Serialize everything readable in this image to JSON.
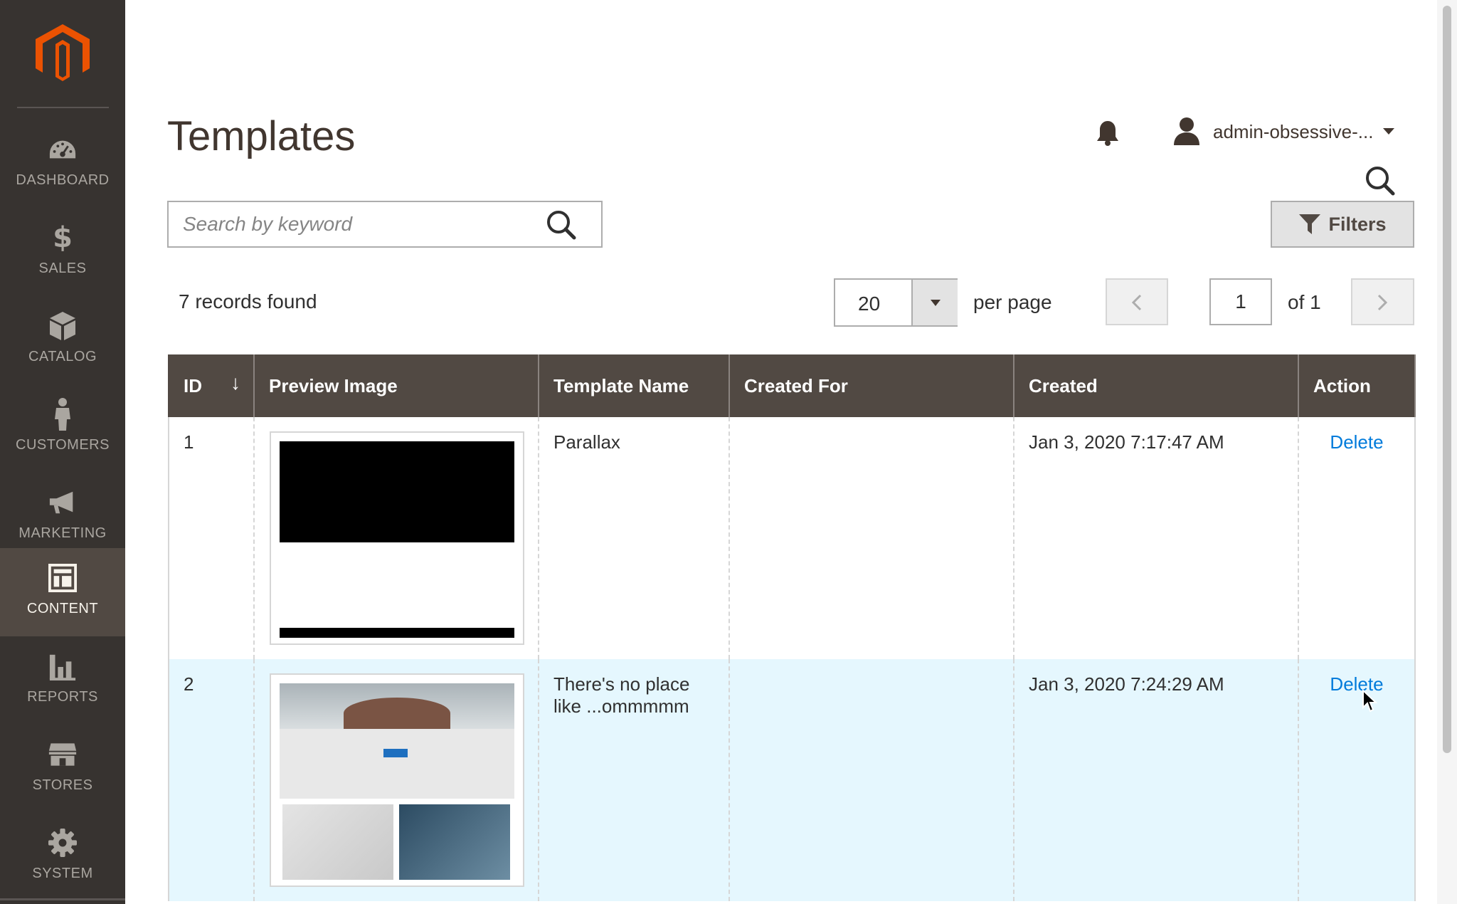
{
  "sidebar": {
    "items": [
      {
        "label": "DASHBOARD",
        "icon": "dashboard-icon"
      },
      {
        "label": "SALES",
        "icon": "dollar-icon"
      },
      {
        "label": "CATALOG",
        "icon": "box-icon"
      },
      {
        "label": "CUSTOMERS",
        "icon": "person-icon"
      },
      {
        "label": "MARKETING",
        "icon": "megaphone-icon"
      },
      {
        "label": "CONTENT",
        "icon": "layout-icon",
        "active": true
      },
      {
        "label": "REPORTS",
        "icon": "bar-chart-icon"
      },
      {
        "label": "STORES",
        "icon": "store-icon"
      },
      {
        "label": "SYSTEM",
        "icon": "gear-icon"
      }
    ]
  },
  "header": {
    "title": "Templates",
    "user": "admin-obsessive-..."
  },
  "search": {
    "placeholder": "Search by keyword",
    "value": ""
  },
  "toolbar": {
    "filters_label": "Filters",
    "records": "7 records found",
    "per_page_value": "20",
    "per_page_label": "per page",
    "page_value": "1",
    "page_of": "of 1"
  },
  "table": {
    "columns": [
      "ID",
      "Preview Image",
      "Template Name",
      "Created For",
      "Created",
      "Action"
    ],
    "rows": [
      {
        "id": "1",
        "name": "Parallax",
        "created_for": "",
        "created": "Jan 3, 2020 7:17:47 AM",
        "action": "Delete"
      },
      {
        "id": "2",
        "name": "There's no place like ...ommmmm",
        "created_for": "",
        "created": "Jan 3, 2020 7:24:29 AM",
        "action": "Delete"
      }
    ]
  },
  "colors": {
    "sidebar": "#373330",
    "sidebar_active": "#514943",
    "header_bg": "#514943",
    "link": "#007bdb",
    "brand": "#eb5202",
    "row_hover": "#e5f7fe"
  }
}
